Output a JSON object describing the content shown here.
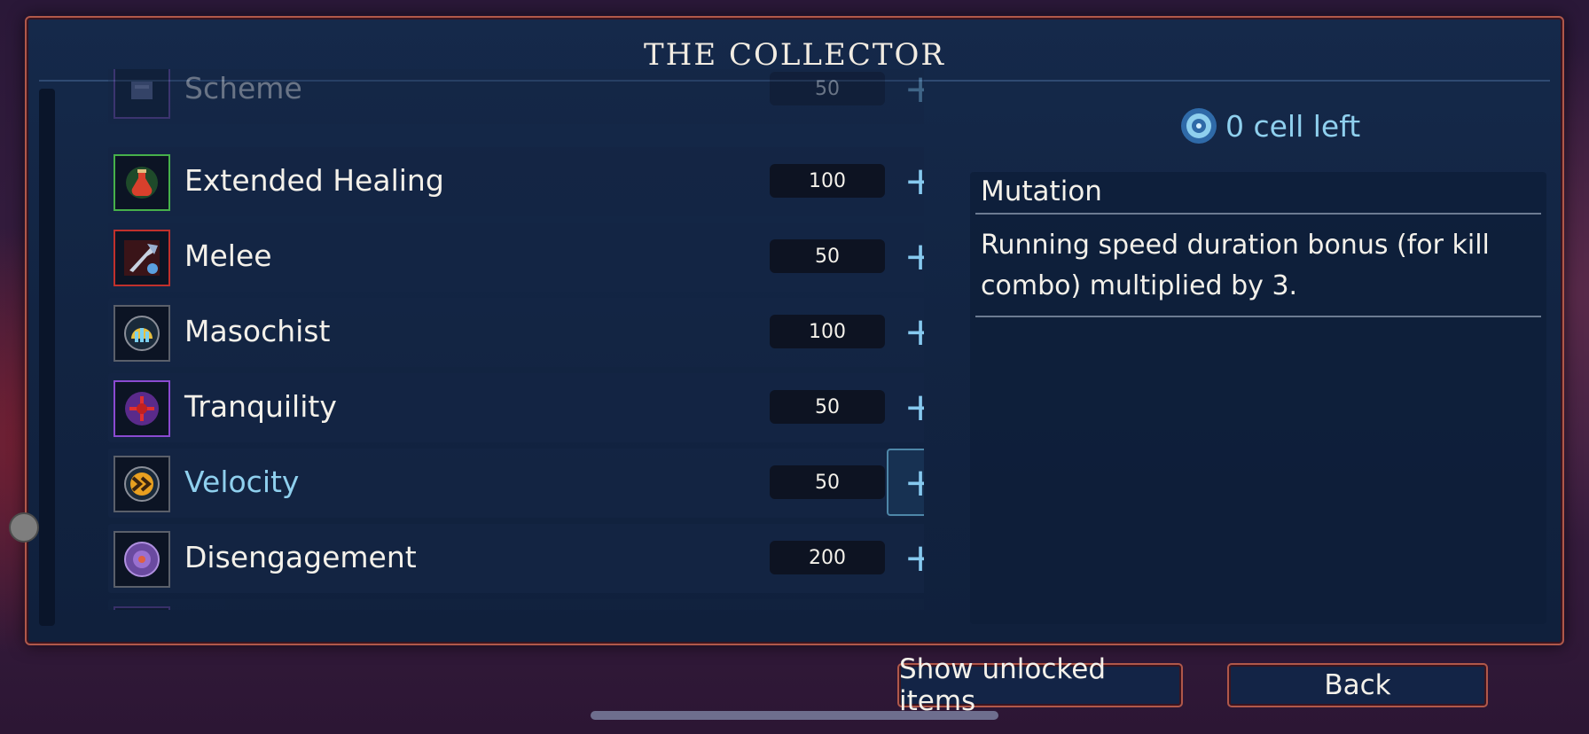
{
  "window": {
    "title": "THE COLLECTOR"
  },
  "items": [
    {
      "name": "Scheme",
      "cost": "50",
      "icon": "scheme-icon",
      "border": "#7a4ab0",
      "faded": true
    },
    {
      "name": "Extended Healing",
      "cost": "100",
      "icon": "healing-flask-icon",
      "border": "#46b04a"
    },
    {
      "name": "Melee",
      "cost": "50",
      "icon": "melee-axe-icon",
      "border": "#c0302c"
    },
    {
      "name": "Masochist",
      "cost": "100",
      "icon": "masochist-icon",
      "border": "#5a5f6a"
    },
    {
      "name": "Tranquility",
      "cost": "50",
      "icon": "tranquility-icon",
      "border": "#8a4ad0"
    },
    {
      "name": "Velocity",
      "cost": "50",
      "icon": "velocity-icon",
      "border": "#5a5f6a",
      "selected": true
    },
    {
      "name": "Disengagement",
      "cost": "200",
      "icon": "disengagement-icon",
      "border": "#5a5f6a"
    }
  ],
  "plus_label": "+",
  "cells": {
    "text": "0 cell left",
    "icon": "cell-icon"
  },
  "detail": {
    "heading": "Mutation",
    "description": "Running speed duration bonus (for kill combo) multiplied by 3."
  },
  "buttons": {
    "show_unlocked": "Show unlocked items",
    "back": "Back"
  },
  "colors": {
    "accent": "#8fd0ee",
    "frame": "#b0584a",
    "panel": "#132446"
  }
}
